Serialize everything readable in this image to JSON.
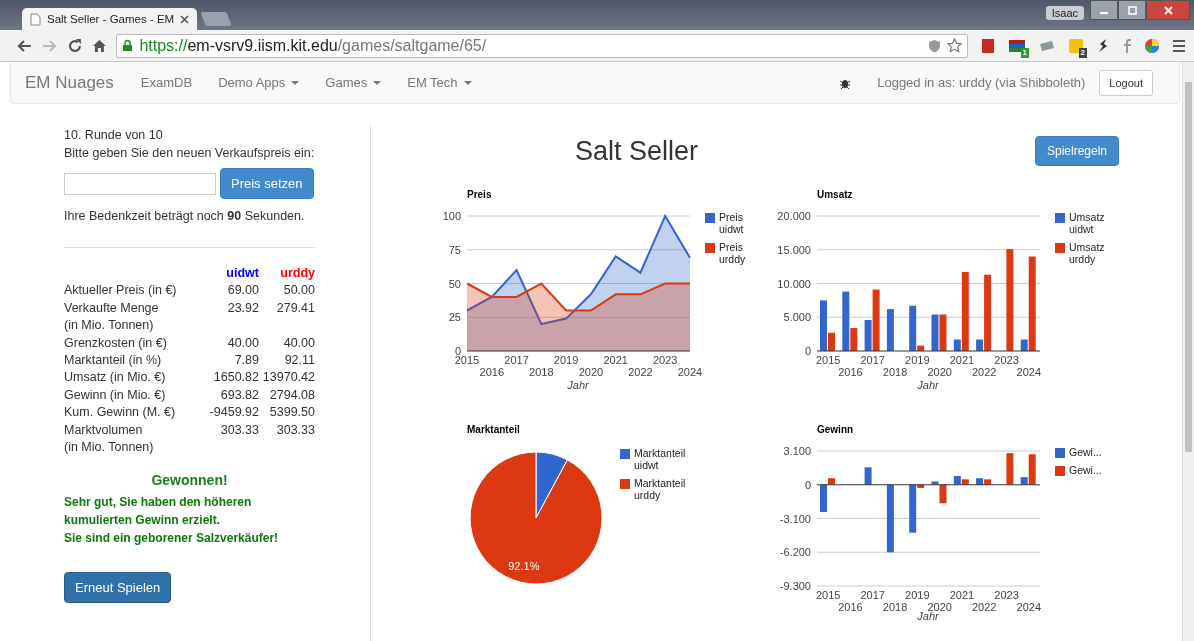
{
  "browser": {
    "tab_title": "Salt Seller - Games - EM",
    "profile": "Isaac",
    "url": {
      "scheme": "https://",
      "host": "em-vsrv9.iism.kit.edu",
      "path": "/games/saltgame/65/"
    },
    "extension_badges": [
      "1",
      "2"
    ]
  },
  "navbar": {
    "brand": "EM Nuages",
    "items": [
      {
        "label": "ExamDB",
        "dropdown": false
      },
      {
        "label": "Demo Apps",
        "dropdown": true
      },
      {
        "label": "Games",
        "dropdown": true
      },
      {
        "label": "EM Tech",
        "dropdown": true
      }
    ],
    "user": "Logged in as: urddy (via Shibboleth)",
    "logout": "Logout"
  },
  "game": {
    "round": "10. Runde von 10",
    "prompt": "Bitte geben Sie den neuen Verkaufspreis ein:",
    "set_price": "Preis setzen",
    "time_left": "Ihre Bedenkzeit beträgt noch **90** Sekunden.",
    "players": [
      {
        "name": "uidwt",
        "color": "#0000ff"
      },
      {
        "name": "urddy",
        "color": "#ff0000"
      }
    ],
    "rows": [
      {
        "label": "Aktueller Preis (in €)",
        "values": [
          "69.00",
          "50.00"
        ]
      },
      {
        "label": "Verkaufte Menge",
        "note": "(in Mio. Tonnen)",
        "values": [
          "23.92",
          "279.41"
        ]
      },
      {
        "label": "Grenzkosten (in €)",
        "values": [
          "40.00",
          "40.00"
        ]
      },
      {
        "label": "Marktanteil (in %)",
        "values": [
          "7.89",
          "92.11"
        ]
      },
      {
        "label": "Umsatz (in Mio. €)",
        "values": [
          "1650.82",
          "13970.42"
        ]
      },
      {
        "label": "Gewinn (in Mio. €)",
        "values": [
          "693.82",
          "2794.08"
        ]
      },
      {
        "label": "Kum. Gewinn (M. €)",
        "values": [
          "-9459.92",
          "5399.50"
        ]
      },
      {
        "label": "Marktvolumen",
        "note": "(in Mio. Tonnen)",
        "values": [
          "303.33",
          "303.33"
        ]
      }
    ],
    "result": {
      "title": "Gewonnen!",
      "lines": [
        "Sehr gut, Sie haben den höheren",
        "kumulierten Gewinn erzielt.",
        "Sie sind ein geborener Salzverkäufer!"
      ]
    },
    "replay": "Erneut Spielen"
  },
  "main": {
    "title": "Salt Seller",
    "rules_button": "Spielregeln",
    "charts": [
      {
        "chart_data": {
          "type": "area",
          "title": "Preis",
          "xlabel": "Jahr",
          "grid": true,
          "legend": "right",
          "categories": [
            "2015",
            "2016",
            "2017",
            "2018",
            "2019",
            "2020",
            "2021",
            "2022",
            "2023",
            "2024"
          ],
          "ylim": [
            0,
            100
          ],
          "yticks": [
            0,
            25,
            50,
            75,
            100
          ],
          "series": [
            {
              "name": "Preis uidwt",
              "color": "#3366cc",
              "values": [
                30,
                40,
                60,
                20,
                24,
                42,
                70,
                58,
                100,
                69
              ]
            },
            {
              "name": "Preis urddy",
              "color": "#dc3912",
              "values": [
                50,
                40,
                40,
                50,
                30,
                30,
                42,
                42,
                50,
                50
              ]
            }
          ]
        }
      },
      {
        "chart_data": {
          "type": "bar",
          "title": "Umsatz",
          "xlabel": "Jahr",
          "grid": true,
          "legend": "right",
          "categories": [
            "2015",
            "2016",
            "2017",
            "2018",
            "2019",
            "2020",
            "2021",
            "2022",
            "2023",
            "2024"
          ],
          "ylim": [
            0,
            20
          ],
          "yticks": [
            {
              "value": 0,
              "label": "0"
            },
            {
              "value": 5,
              "label": "5.000"
            },
            {
              "value": 10,
              "label": "10.000"
            },
            {
              "value": 15,
              "label": "15.000"
            },
            {
              "value": 20,
              "label": "20.000"
            }
          ],
          "series": [
            {
              "name": "Umsatz uidwt",
              "color": "#3366cc",
              "values": [
                7.5,
                8.8,
                4.6,
                6.2,
                6.7,
                5.4,
                1.7,
                1.7,
                0,
                1.7
              ]
            },
            {
              "name": "Umsatz urddy",
              "color": "#dc3912",
              "values": [
                2.7,
                3.4,
                9.1,
                0,
                0.8,
                5.4,
                11.7,
                11.3,
                15.1,
                14.0
              ]
            }
          ]
        }
      },
      {
        "chart_data": {
          "type": "pie",
          "title": "Marktanteil",
          "legend": "right",
          "categories": [
            "Marktanteil uidwt",
            "Marktanteil urddy"
          ],
          "values": [
            7.89,
            92.11
          ],
          "value_labels": [
            null,
            "92.1%"
          ]
        }
      },
      {
        "chart_data": {
          "type": "bar",
          "title": "Gewinn",
          "xlabel": "Jahr",
          "grid": true,
          "legend": "right",
          "categories": [
            "2015",
            "2016",
            "2017",
            "2018",
            "2019",
            "2020",
            "2021",
            "2022",
            "2023",
            "2024"
          ],
          "ylim": [
            -9.3,
            3.1
          ],
          "yticks": [
            {
              "value": -9.3,
              "label": "-9.300"
            },
            {
              "value": -6.2,
              "label": "-6.200"
            },
            {
              "value": -3.1,
              "label": "-3.100"
            },
            {
              "value": 0,
              "label": "0"
            },
            {
              "value": 3.1,
              "label": "3.100"
            }
          ],
          "series": [
            {
              "name": "Gewi...",
              "color": "#3366cc",
              "values": [
                -2.5,
                0,
                1.6,
                -6.2,
                -4.4,
                0.3,
                0.8,
                0.6,
                0,
                0.7
              ]
            },
            {
              "name": "Gewi...",
              "color": "#dc3912",
              "values": [
                0.6,
                0,
                0,
                0,
                -0.3,
                -1.7,
                0.5,
                0.5,
                2.9,
                2.8
              ]
            }
          ]
        }
      }
    ]
  }
}
